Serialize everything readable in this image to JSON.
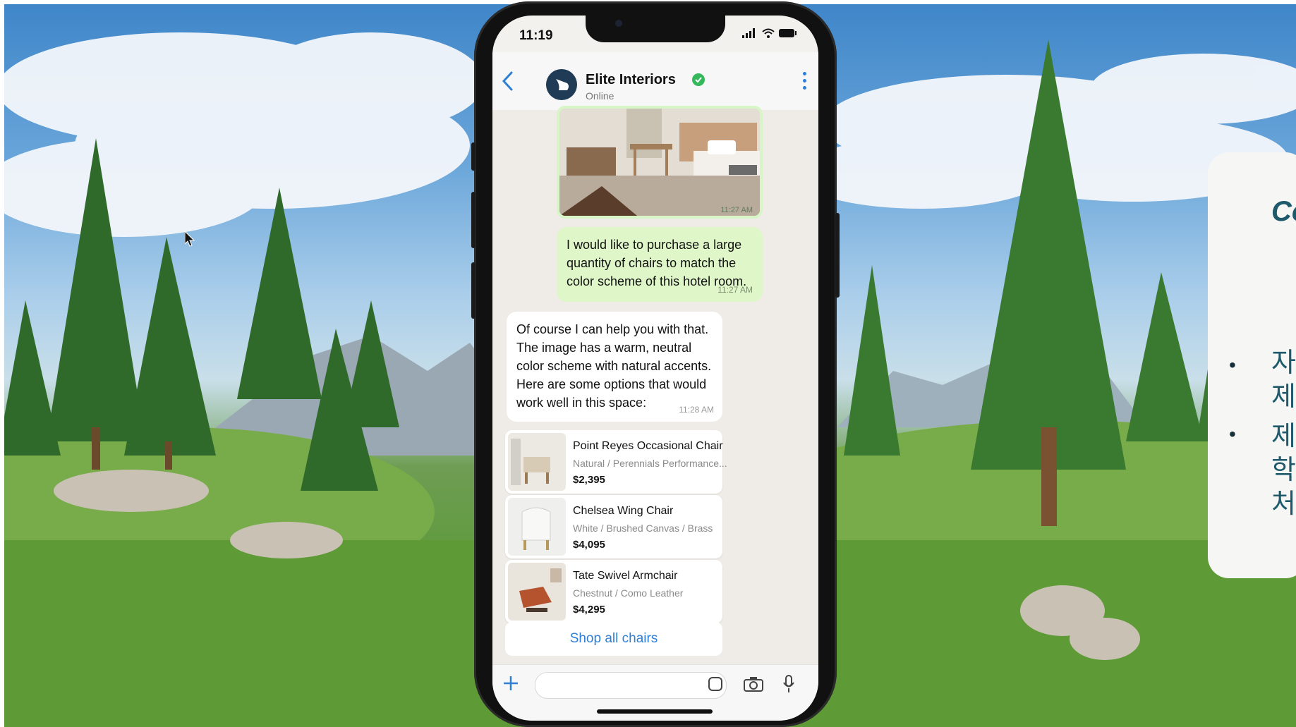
{
  "phone": {
    "status_time": "11:19",
    "contact": {
      "name": "Elite Interiors",
      "status": "Online"
    },
    "messages": {
      "image_time": "11:27 AM",
      "outgoing_text": "I would like to purchase a large quantity of chairs to match the color scheme of this hotel room.",
      "outgoing_time": "11:27 AM",
      "incoming_text": "Of course I can help you with that. The image has a warm, neutral color scheme with natural accents. Here are some options that would work well in this space:",
      "incoming_time": "11:28 AM"
    },
    "products": [
      {
        "name": "Point Reyes Occasional Chair",
        "variant": "Natural / Perennials Performance...",
        "price": "$2,395"
      },
      {
        "name": "Chelsea Wing Chair",
        "variant": "White / Brushed Canvas / Brass",
        "price": "$4,095"
      },
      {
        "name": "Tate Swivel Armchair",
        "variant": "Chestnut / Como Leather",
        "price": "$4,295"
      }
    ],
    "shop_all_label": "Shop all chairs",
    "icons": {
      "back": "chevron-left-icon",
      "menu": "more-vertical-icon",
      "verified": "verified-badge-icon",
      "add": "plus-icon",
      "sticker": "sticker-icon",
      "camera": "camera-icon",
      "mic": "microphone-icon"
    },
    "colors": {
      "accent": "#2f7fd6",
      "outgoing_bubble": "#dff6c9",
      "verified": "#34b85b"
    }
  },
  "side_card": {
    "title": "Co",
    "bullets": [
      "자\n제",
      "제\n학\n처"
    ]
  }
}
